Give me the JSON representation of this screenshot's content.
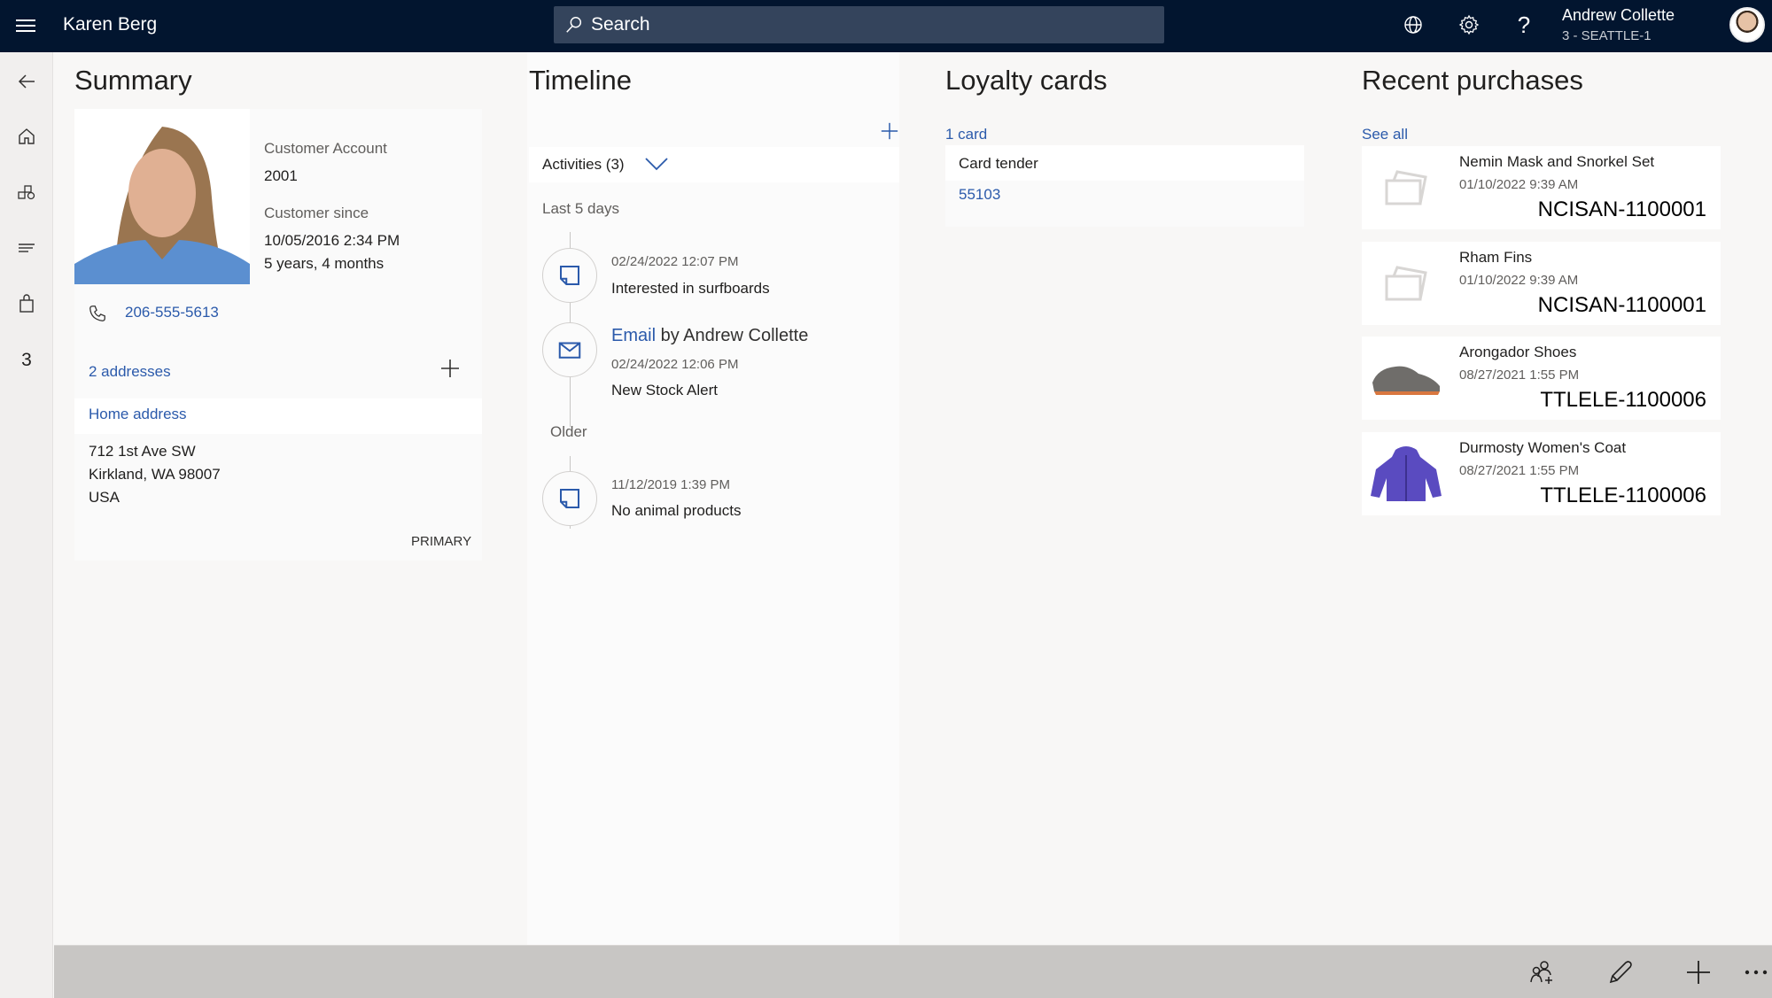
{
  "header": {
    "title": "Karen Berg",
    "search_placeholder": "Search",
    "user": {
      "name": "Andrew Collette",
      "store": "3 - SEATTLE-1"
    },
    "icons": [
      "menu-icon",
      "search-icon",
      "globe-icon",
      "gear-icon",
      "help-icon",
      "avatar"
    ]
  },
  "leftnav": {
    "items": [
      {
        "icon": "back-arrow-icon"
      },
      {
        "icon": "home-icon"
      },
      {
        "icon": "products-icon"
      },
      {
        "icon": "list-icon"
      },
      {
        "icon": "shopping-bag-icon"
      }
    ],
    "count": "3"
  },
  "summary": {
    "title": "Summary",
    "account_label": "Customer Account",
    "account_value": "2001",
    "since_label": "Customer since",
    "since_date": "10/05/2016 2:34 PM",
    "since_duration": "5 years, 4 months",
    "phone": "206-555-5613",
    "addresses_link": "2 addresses",
    "address_type": "Home address",
    "address_line1": "712 1st Ave SW",
    "address_line2": "Kirkland, WA 98007",
    "address_line3": "USA",
    "address_badge": "PRIMARY"
  },
  "timeline": {
    "title": "Timeline",
    "filter_label": "Activities (3)",
    "groups": [
      {
        "label": "Last 5 days",
        "items": [
          {
            "type": "note",
            "date": "02/24/2022 12:07 PM",
            "text": "Interested in surfboards"
          },
          {
            "type": "email",
            "kind": "Email",
            "by": "by Andrew Collette",
            "date": "02/24/2022 12:06 PM",
            "text": "New Stock Alert"
          }
        ]
      },
      {
        "label": "Older",
        "items": [
          {
            "type": "note",
            "date": "11/12/2019 1:39 PM",
            "text": "No animal products"
          }
        ]
      }
    ]
  },
  "loyalty": {
    "title": "Loyalty cards",
    "count_link": "1 card",
    "card_type": "Card tender",
    "card_number": "55103"
  },
  "purchases": {
    "title": "Recent purchases",
    "see_all": "See all",
    "items": [
      {
        "name": "Nemin Mask and Snorkel Set",
        "date": "01/10/2022 9:39 AM",
        "order": "NCISAN-1100001",
        "image": "placeholder-image-icon"
      },
      {
        "name": "Rham Fins",
        "date": "01/10/2022 9:39 AM",
        "order": "NCISAN-1100001",
        "image": "placeholder-image-icon"
      },
      {
        "name": "Arongador Shoes",
        "date": "08/27/2021 1:55 PM",
        "order": "TTLELE-1100006",
        "image": "shoe-image"
      },
      {
        "name": "Durmosty Women's Coat",
        "date": "08/27/2021 1:55 PM",
        "order": "TTLELE-1100006",
        "image": "coat-image"
      }
    ]
  },
  "bottombar": {
    "actions": [
      "add-customer-icon",
      "edit-icon",
      "add-icon",
      "more-icon"
    ]
  },
  "colors": {
    "header_bg": "#02152f",
    "search_bg": "#34445c",
    "link": "#2b5aab",
    "bottombar_bg": "#c8c6c4"
  }
}
